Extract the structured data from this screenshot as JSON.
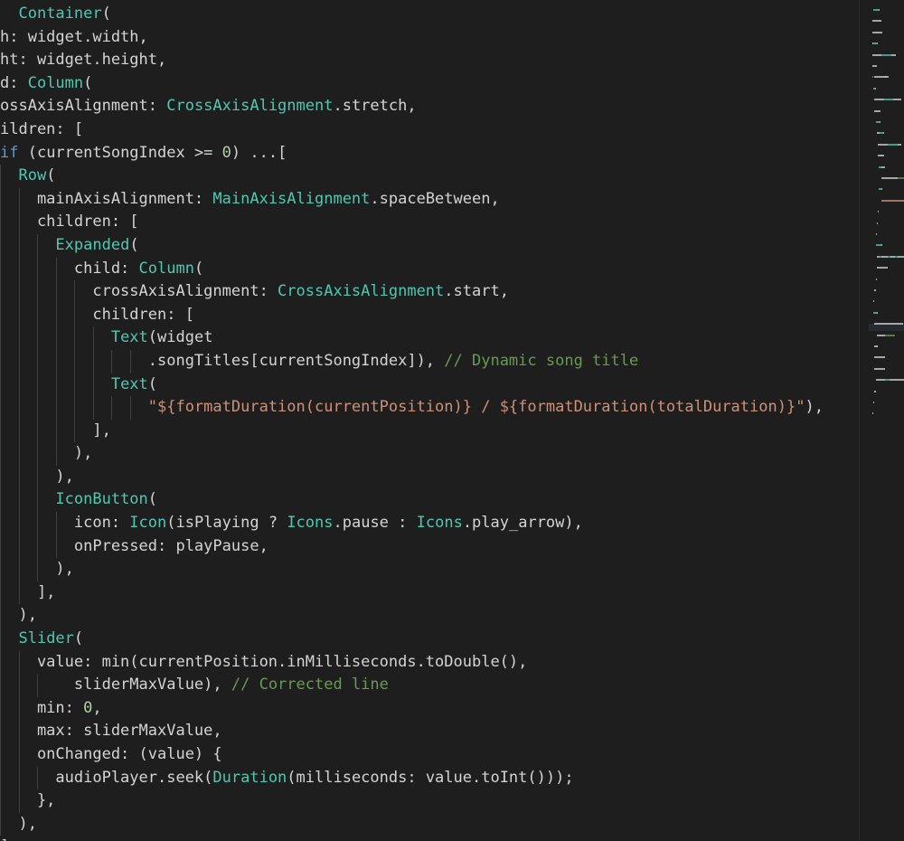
{
  "editor": {
    "colors": {
      "background": "#1e1e1e",
      "text": "#d4d4d4",
      "type": "#4ec9b0",
      "keyword": "#569cd6",
      "string": "#ce9178",
      "number": "#b5cea8",
      "comment": "#6a9955",
      "indent_guide": "#404040"
    },
    "lines": [
      {
        "indent": 0,
        "tokens": [
          {
            "t": "  ",
            "c": "text"
          },
          {
            "t": "Container",
            "c": "type"
          },
          {
            "t": "(",
            "c": "text"
          }
        ]
      },
      {
        "indent": 0,
        "tokens": [
          {
            "t": "h: widget.width,",
            "c": "text"
          }
        ]
      },
      {
        "indent": 0,
        "tokens": [
          {
            "t": "ht: widget.height,",
            "c": "text"
          }
        ]
      },
      {
        "indent": 0,
        "tokens": [
          {
            "t": "d: ",
            "c": "text"
          },
          {
            "t": "Column",
            "c": "type"
          },
          {
            "t": "(",
            "c": "text"
          }
        ]
      },
      {
        "indent": 0,
        "tokens": [
          {
            "t": "ossAxisAlignment: ",
            "c": "text"
          },
          {
            "t": "CrossAxisAlignment",
            "c": "type"
          },
          {
            "t": ".stretch,",
            "c": "text"
          }
        ]
      },
      {
        "indent": 0,
        "tokens": [
          {
            "t": "ildren: [",
            "c": "text"
          }
        ]
      },
      {
        "indent": 0,
        "tokens": [
          {
            "t": "if",
            "c": "kw"
          },
          {
            "t": " (currentSongIndex >= ",
            "c": "text"
          },
          {
            "t": "0",
            "c": "num"
          },
          {
            "t": ") ...[",
            "c": "text"
          }
        ]
      },
      {
        "indent": 1,
        "tokens": [
          {
            "t": "  ",
            "c": "text"
          },
          {
            "t": "Row",
            "c": "type"
          },
          {
            "t": "(",
            "c": "text"
          }
        ]
      },
      {
        "indent": 2,
        "tokens": [
          {
            "t": "    mainAxisAlignment: ",
            "c": "text"
          },
          {
            "t": "MainAxisAlignment",
            "c": "type"
          },
          {
            "t": ".spaceBetween,",
            "c": "text"
          }
        ]
      },
      {
        "indent": 2,
        "tokens": [
          {
            "t": "    children: [",
            "c": "text"
          }
        ]
      },
      {
        "indent": 3,
        "tokens": [
          {
            "t": "      ",
            "c": "text"
          },
          {
            "t": "Expanded",
            "c": "type"
          },
          {
            "t": "(",
            "c": "text"
          }
        ]
      },
      {
        "indent": 4,
        "tokens": [
          {
            "t": "        child: ",
            "c": "text"
          },
          {
            "t": "Column",
            "c": "type"
          },
          {
            "t": "(",
            "c": "text"
          }
        ]
      },
      {
        "indent": 5,
        "tokens": [
          {
            "t": "          crossAxisAlignment: ",
            "c": "text"
          },
          {
            "t": "CrossAxisAlignment",
            "c": "type"
          },
          {
            "t": ".start,",
            "c": "text"
          }
        ]
      },
      {
        "indent": 5,
        "tokens": [
          {
            "t": "          children: [",
            "c": "text"
          }
        ]
      },
      {
        "indent": 6,
        "tokens": [
          {
            "t": "            ",
            "c": "text"
          },
          {
            "t": "Text",
            "c": "type"
          },
          {
            "t": "(widget",
            "c": "text"
          }
        ]
      },
      {
        "indent": 8,
        "tokens": [
          {
            "t": "                .songTitles[currentSongIndex]), ",
            "c": "text"
          },
          {
            "t": "// Dynamic song title",
            "c": "cmt"
          }
        ]
      },
      {
        "indent": 6,
        "tokens": [
          {
            "t": "            ",
            "c": "text"
          },
          {
            "t": "Text",
            "c": "type"
          },
          {
            "t": "(",
            "c": "text"
          }
        ]
      },
      {
        "indent": 8,
        "tokens": [
          {
            "t": "                ",
            "c": "text"
          },
          {
            "t": "\"${formatDuration(currentPosition)} / ${formatDuration(totalDuration)}\"",
            "c": "str"
          },
          {
            "t": "),",
            "c": "text"
          }
        ]
      },
      {
        "indent": 5,
        "tokens": [
          {
            "t": "          ],",
            "c": "text"
          }
        ]
      },
      {
        "indent": 4,
        "tokens": [
          {
            "t": "        ),",
            "c": "text"
          }
        ]
      },
      {
        "indent": 3,
        "tokens": [
          {
            "t": "      ),",
            "c": "text"
          }
        ]
      },
      {
        "indent": 3,
        "tokens": [
          {
            "t": "      ",
            "c": "text"
          },
          {
            "t": "IconButton",
            "c": "type"
          },
          {
            "t": "(",
            "c": "text"
          }
        ]
      },
      {
        "indent": 4,
        "tokens": [
          {
            "t": "        icon: ",
            "c": "text"
          },
          {
            "t": "Icon",
            "c": "type"
          },
          {
            "t": "(isPlaying ? ",
            "c": "text"
          },
          {
            "t": "Icons",
            "c": "type"
          },
          {
            "t": ".pause : ",
            "c": "text"
          },
          {
            "t": "Icons",
            "c": "type"
          },
          {
            "t": ".play_arrow),",
            "c": "text"
          }
        ]
      },
      {
        "indent": 4,
        "tokens": [
          {
            "t": "        onPressed: playPause,",
            "c": "text"
          }
        ]
      },
      {
        "indent": 3,
        "tokens": [
          {
            "t": "      ),",
            "c": "text"
          }
        ]
      },
      {
        "indent": 2,
        "tokens": [
          {
            "t": "    ],",
            "c": "text"
          }
        ]
      },
      {
        "indent": 1,
        "tokens": [
          {
            "t": "  ),",
            "c": "text"
          }
        ]
      },
      {
        "indent": 1,
        "tokens": [
          {
            "t": "  ",
            "c": "text"
          },
          {
            "t": "Slider",
            "c": "type"
          },
          {
            "t": "(",
            "c": "text"
          }
        ]
      },
      {
        "indent": 2,
        "tokens": [
          {
            "t": "    value: min(currentPosition.inMilliseconds.toDouble(),",
            "c": "text"
          }
        ]
      },
      {
        "indent": 3,
        "tokens": [
          {
            "t": "        sliderMaxValue), ",
            "c": "text"
          },
          {
            "t": "// Corrected line",
            "c": "cmt"
          }
        ]
      },
      {
        "indent": 2,
        "tokens": [
          {
            "t": "    min: ",
            "c": "text"
          },
          {
            "t": "0",
            "c": "num"
          },
          {
            "t": ",",
            "c": "text"
          }
        ]
      },
      {
        "indent": 2,
        "tokens": [
          {
            "t": "    max: sliderMaxValue,",
            "c": "text"
          }
        ]
      },
      {
        "indent": 2,
        "tokens": [
          {
            "t": "    onChanged: (value) {",
            "c": "text"
          }
        ]
      },
      {
        "indent": 3,
        "tokens": [
          {
            "t": "      audioPlayer.seek(",
            "c": "text"
          },
          {
            "t": "Duration",
            "c": "type"
          },
          {
            "t": "(milliseconds: value.toInt()));",
            "c": "text"
          }
        ]
      },
      {
        "indent": 2,
        "tokens": [
          {
            "t": "    },",
            "c": "text"
          }
        ]
      },
      {
        "indent": 1,
        "tokens": [
          {
            "t": "  ),",
            "c": "text"
          }
        ]
      },
      {
        "indent": 0,
        "tokens": [
          {
            "t": "],",
            "c": "text"
          }
        ]
      }
    ]
  }
}
